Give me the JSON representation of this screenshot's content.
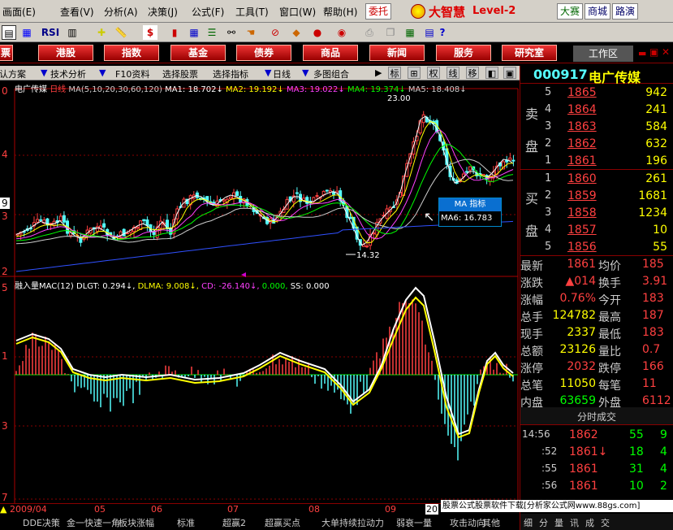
{
  "menu": [
    "画面(E)",
    "查看(V)",
    "分析(A)",
    "决策(J)",
    "公式(F)",
    "工具(T)",
    "窗口(W)",
    "帮助(H)"
  ],
  "brand": {
    "weituo": "委托",
    "logo": "大智慧",
    "level": "Level-2",
    "dasai": "大赛",
    "shangcheng": "商城",
    "luyan": "路演"
  },
  "tabs": {
    "first": "票",
    "items": [
      "港股",
      "指数",
      "基金",
      "债券",
      "商品",
      "新闻",
      "服务",
      "研究室"
    ],
    "workspace": "工作区"
  },
  "subbar": {
    "scheme": "默认方案",
    "tech": "技术分析",
    "f10": "F10资料",
    "pick_stock": "选择股票",
    "pick_indicator": "选择指标",
    "period": "日线",
    "multi": "多图组合",
    "btn_biao": "标",
    "btn_quan": "权",
    "btn_xian": "线",
    "btn_yi": "移"
  },
  "stock": {
    "code": "000917",
    "name": "电广传媒"
  },
  "chart": {
    "title": "电广传媒",
    "period": "日线",
    "ma_label": "MA(5,10,20,30,60,120)",
    "ma1": "MA1: 18.702",
    "ma2": "MA2: 19.192",
    "ma3": "MA3: 19.022",
    "ma4": "MA4: 19.374",
    "ma5": "MA5: 18.408",
    "high_mark": "23.00",
    "low_mark": "14.32",
    "tooltip_title": "MA 指标",
    "tooltip_value": "MA6: 16.783",
    "yaxis_top": [
      "0",
      "4",
      "9",
      "3",
      "2"
    ],
    "ind_label": "融入量MAC(12)",
    "dlgt": "DLGT: 0.294",
    "dlma": "DLMA: 9.008",
    "cd": "CD: -26.140",
    "v0": "0.000",
    "ss": "SS: 0.000",
    "yaxis_bottom": [
      "5",
      "1",
      "3",
      "7"
    ],
    "months": [
      "2009/04",
      "05",
      "06",
      "07",
      "08",
      "09",
      "20"
    ]
  },
  "sell": {
    "label1": "卖",
    "label2": "盘",
    "rows": [
      [
        "5",
        "1865",
        "942"
      ],
      [
        "4",
        "1864",
        "241"
      ],
      [
        "3",
        "1863",
        "584"
      ],
      [
        "2",
        "1862",
        "632"
      ],
      [
        "1",
        "1861",
        "196"
      ]
    ]
  },
  "buy": {
    "label1": "买",
    "label2": "盘",
    "rows": [
      [
        "1",
        "1860",
        "261"
      ],
      [
        "2",
        "1859",
        "1681"
      ],
      [
        "3",
        "1858",
        "1234"
      ],
      [
        "4",
        "1857",
        "10"
      ],
      [
        "5",
        "1856",
        "55"
      ]
    ]
  },
  "quote": [
    {
      "l": "最新",
      "v": "1861",
      "l2": "均价",
      "v2": "185"
    },
    {
      "l": "涨跌",
      "v": "▲014",
      "l2": "换手",
      "v2": "3.91"
    },
    {
      "l": "涨幅",
      "v": "0.76%",
      "l2": "今开",
      "v2": "183"
    },
    {
      "l": "总手",
      "v": "124782",
      "l2": "最高",
      "v2": "187"
    },
    {
      "l": "现手",
      "v": "2337",
      "l2": "最低",
      "v2": "183"
    },
    {
      "l": "总额",
      "v": "23126",
      "l2": "量比",
      "v2": "0.7"
    },
    {
      "l": "涨停",
      "v": "2032",
      "l2": "跌停",
      "v2": "166"
    },
    {
      "l": "总笔",
      "v": "11050",
      "l2": "每笔",
      "v2": "11"
    },
    {
      "l": "内盘",
      "v": "63659",
      "l2": "外盘",
      "v2": "6112"
    }
  ],
  "ticks_header": "分时成交",
  "ticks": [
    [
      "14:56",
      "1862",
      "55",
      "9"
    ],
    [
      ":52",
      "1861↓",
      "18",
      "4"
    ],
    [
      ":55",
      "1861",
      "31",
      "4"
    ],
    [
      ":56",
      "1861",
      "10",
      "2"
    ]
  ],
  "bottom": {
    "watermark": "股票公式股票软件下载[分析家公式网www.88gs.com]",
    "indicators": [
      "DDE决策",
      "金一快速一角",
      "板块涨幅",
      "标准",
      "超赢2",
      "超赢买点",
      "大单持续拉动力",
      "弱衰一量",
      "攻击动向",
      "其他"
    ]
  },
  "colors": {
    "up": "#ff4040",
    "down": "#54fcfc",
    "yellow": "#ffff00",
    "green": "#00ff00",
    "blue": "#3050ff"
  }
}
